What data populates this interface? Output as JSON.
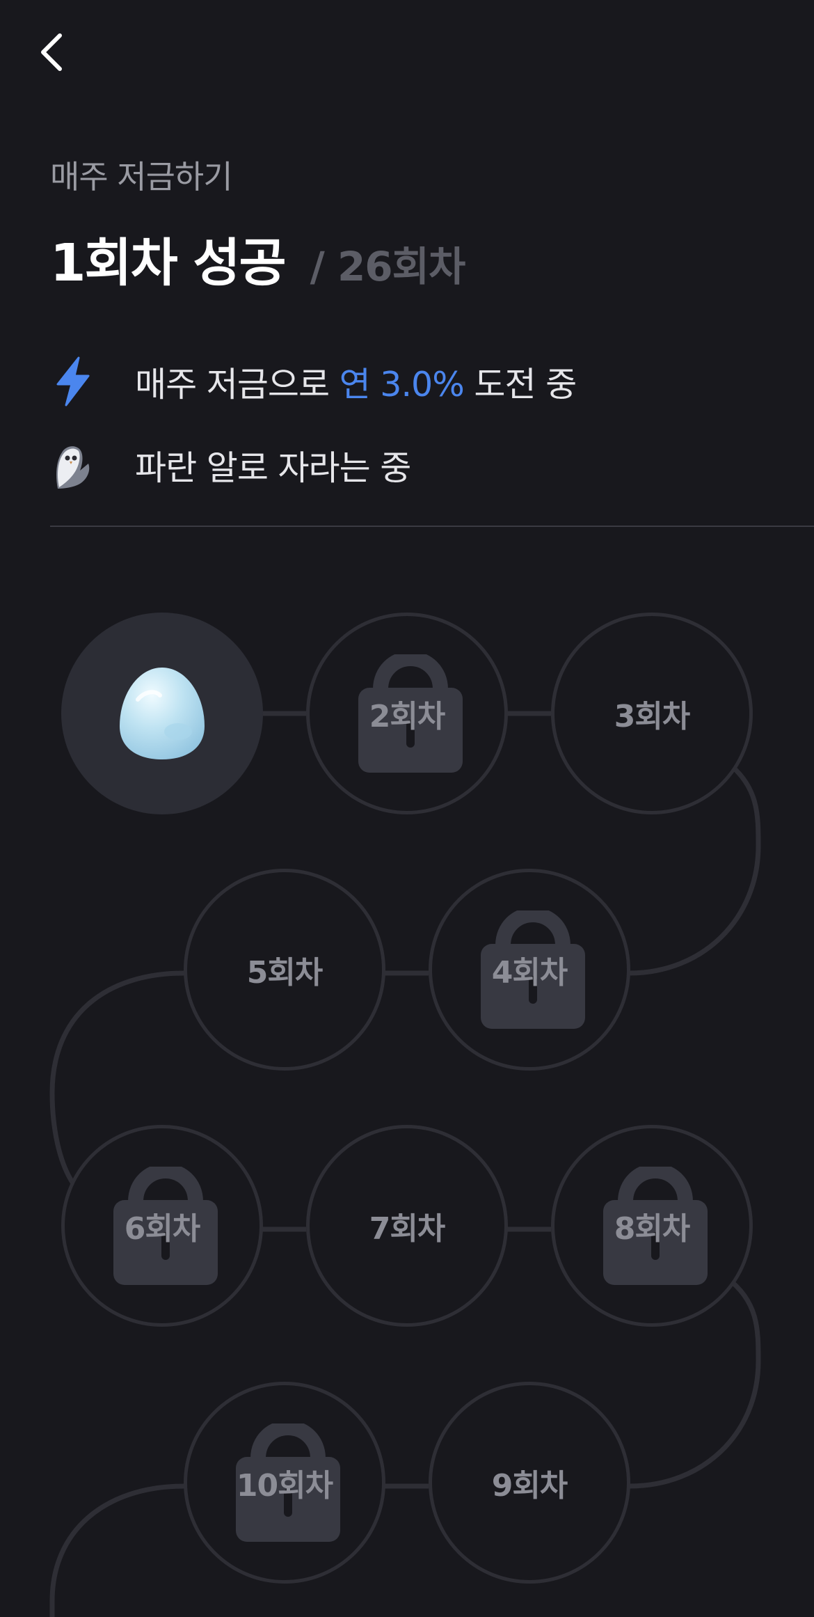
{
  "header": {
    "back_icon": "chevron-left-icon"
  },
  "page": {
    "subtitle": "매주 저금하기"
  },
  "progress": {
    "success_text": "1회차 성공",
    "total_text": "/ 26회차"
  },
  "info": [
    {
      "icon": "lightning-icon",
      "prefix": "매주 저금으로 ",
      "accent": "연 3.0%",
      "suffix": " 도전 중"
    },
    {
      "icon": "owl-bird-icon",
      "text": "파란 알로 자라는 중"
    }
  ],
  "colors": {
    "accent": "#4b86ee",
    "background": "#18181d",
    "egg": "#bfe3f2"
  },
  "rounds": [
    {
      "label": "",
      "status": "done",
      "icon": "blue-egg-icon"
    },
    {
      "label": "2회차",
      "status": "locked"
    },
    {
      "label": "3회차",
      "status": "open"
    },
    {
      "label": "4회차",
      "status": "locked"
    },
    {
      "label": "5회차",
      "status": "open"
    },
    {
      "label": "6회차",
      "status": "locked"
    },
    {
      "label": "7회차",
      "status": "open"
    },
    {
      "label": "8회차",
      "status": "locked"
    },
    {
      "label": "9회차",
      "status": "open"
    },
    {
      "label": "10회차",
      "status": "locked"
    }
  ]
}
